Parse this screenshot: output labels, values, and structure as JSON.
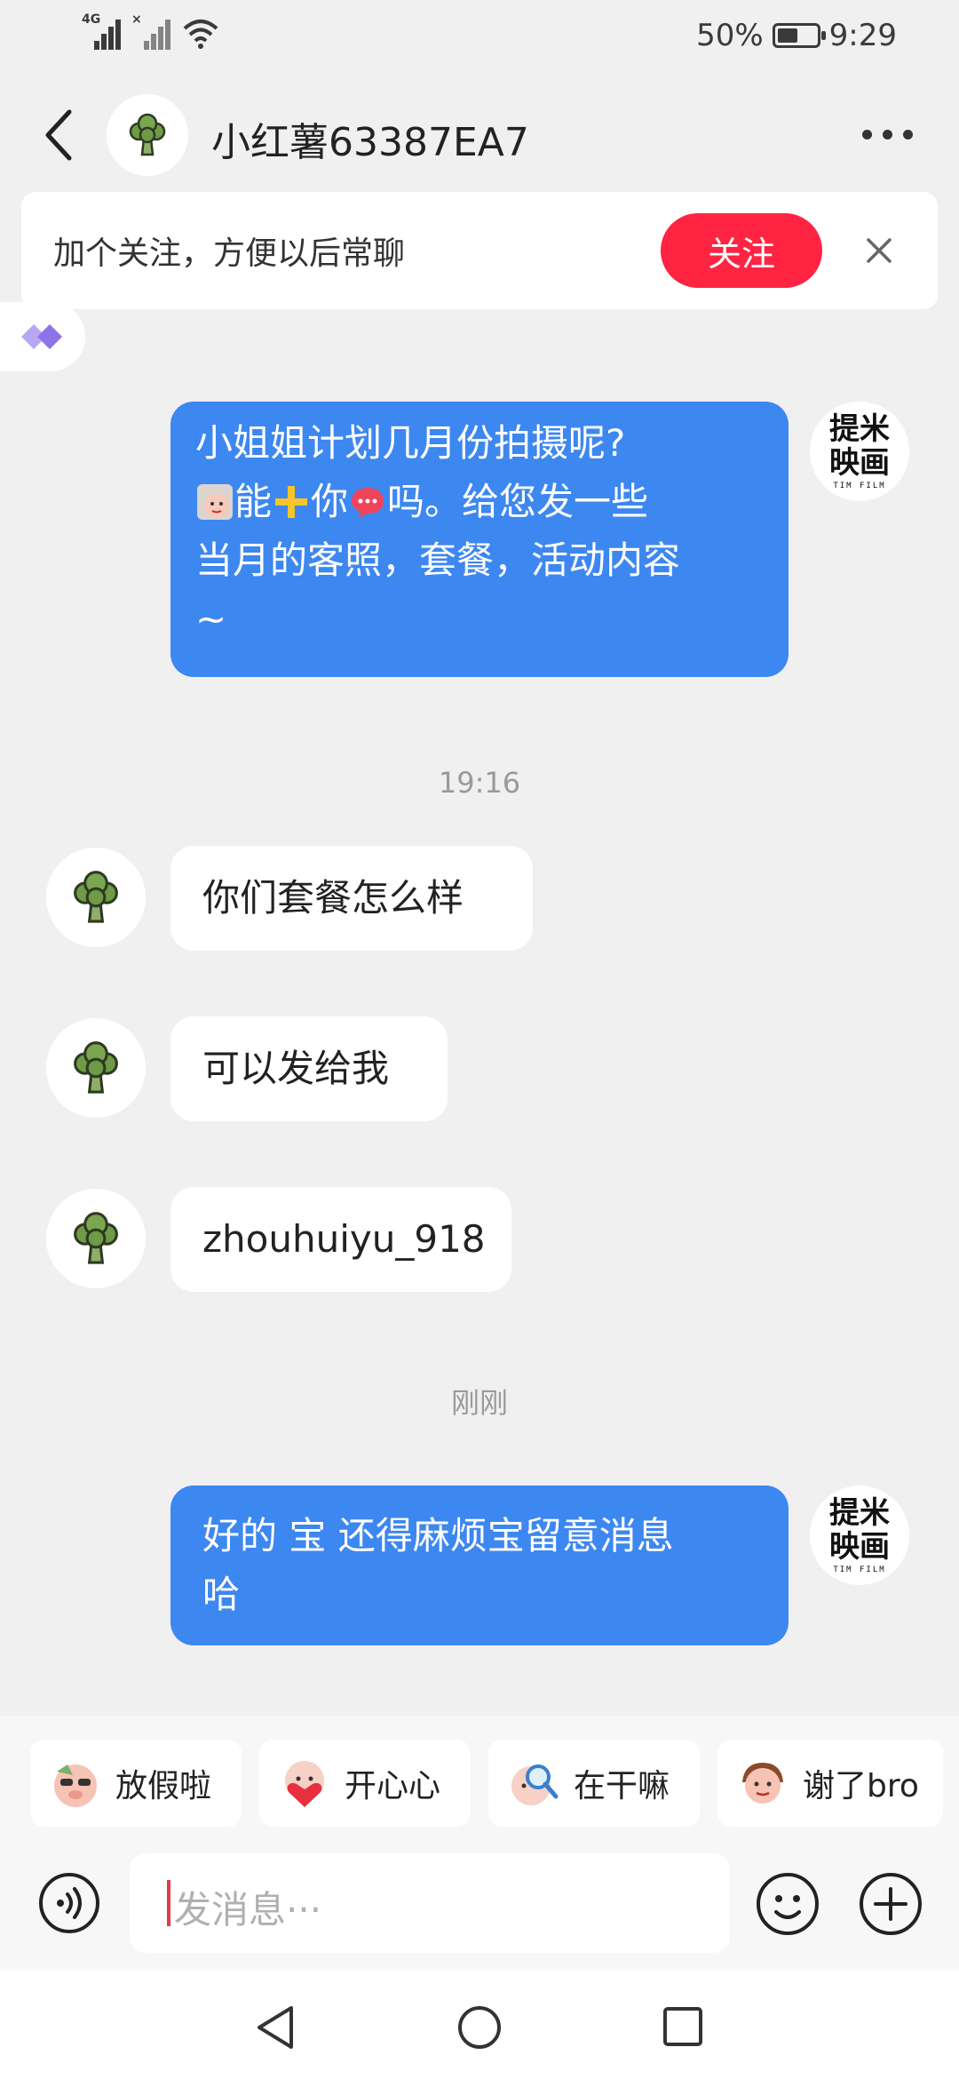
{
  "status_bar": {
    "network_1": "4G",
    "network_2": "×",
    "battery_percent": "50%",
    "time": "9:29"
  },
  "header": {
    "title": "小红薯63387EA7"
  },
  "follow_banner": {
    "text": "加个关注，方便以后常聊",
    "button": "关注"
  },
  "brand_avatar": {
    "line1": "提米",
    "line2": "映画",
    "mark": "TIM FILM"
  },
  "messages": [
    {
      "direction": "out",
      "line1": "小姐姐计划几月份拍摄呢?",
      "line2_a": "能",
      "line2_b": "你",
      "line2_c": "吗。给您发一些",
      "line3": "当月的客照，套餐，活动内容",
      "line4": "~"
    },
    {
      "type": "time",
      "text": "19:16"
    },
    {
      "direction": "in",
      "text": "你们套餐怎么样"
    },
    {
      "direction": "in",
      "text": "可以发给我"
    },
    {
      "direction": "in",
      "text": "zhouhuiyu_918"
    },
    {
      "type": "time",
      "text": "刚刚"
    },
    {
      "direction": "out",
      "line1": "好的 宝 还得麻烦宝留意消息",
      "line2": "哈"
    }
  ],
  "quick_replies": [
    {
      "label": "放假啦",
      "sticker": "pig-sunglasses-sticker"
    },
    {
      "label": "开心心",
      "sticker": "pig-heart-sticker"
    },
    {
      "label": "在干嘛",
      "sticker": "pig-magnifier-sticker"
    },
    {
      "label": "谢了bro",
      "sticker": "pig-thumbs-sticker"
    }
  ],
  "input": {
    "placeholder": "发消息···"
  },
  "colors": {
    "accent_red": "#ff2442",
    "bubble_blue": "#3d87f0",
    "background": "#f0f0f0"
  }
}
